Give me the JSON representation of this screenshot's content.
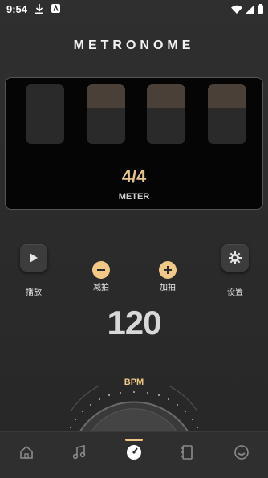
{
  "status_bar": {
    "time": "9:54"
  },
  "title": "METRONOME",
  "beats": [
    {
      "accent": false
    },
    {
      "accent": true
    },
    {
      "accent": true
    },
    {
      "accent": true
    }
  ],
  "meter": {
    "value": "4/4",
    "label": "METER"
  },
  "controls": {
    "play_label": "播放",
    "decrease_label": "减拍",
    "increase_label": "加拍",
    "settings_label": "设置"
  },
  "tempo": {
    "value": "120",
    "unit_label": "BPM"
  },
  "nav": {
    "items": [
      "home-icon",
      "music-icon",
      "metronome-icon",
      "book-icon",
      "smile-icon"
    ],
    "active_index": 2
  },
  "colors": {
    "accent": "#f1c886",
    "panel": "#050505",
    "background": "#2b2b2b"
  }
}
